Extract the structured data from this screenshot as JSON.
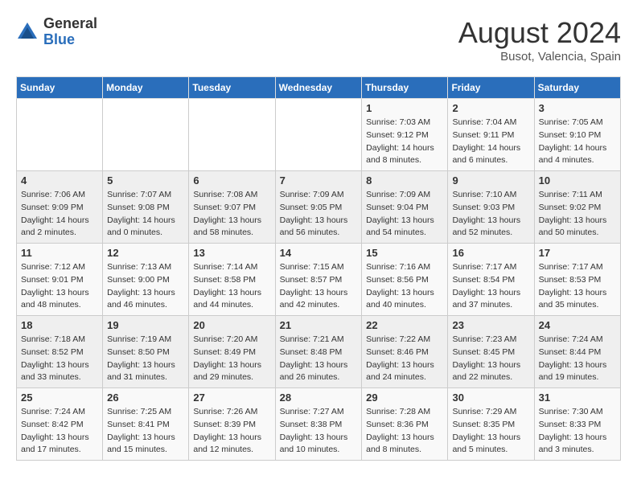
{
  "header": {
    "logo_general": "General",
    "logo_blue": "Blue",
    "month_year": "August 2024",
    "location": "Busot, Valencia, Spain"
  },
  "days_of_week": [
    "Sunday",
    "Monday",
    "Tuesday",
    "Wednesday",
    "Thursday",
    "Friday",
    "Saturday"
  ],
  "weeks": [
    [
      {
        "day": "",
        "info": ""
      },
      {
        "day": "",
        "info": ""
      },
      {
        "day": "",
        "info": ""
      },
      {
        "day": "",
        "info": ""
      },
      {
        "day": "1",
        "info": "Sunrise: 7:03 AM\nSunset: 9:12 PM\nDaylight: 14 hours\nand 8 minutes."
      },
      {
        "day": "2",
        "info": "Sunrise: 7:04 AM\nSunset: 9:11 PM\nDaylight: 14 hours\nand 6 minutes."
      },
      {
        "day": "3",
        "info": "Sunrise: 7:05 AM\nSunset: 9:10 PM\nDaylight: 14 hours\nand 4 minutes."
      }
    ],
    [
      {
        "day": "4",
        "info": "Sunrise: 7:06 AM\nSunset: 9:09 PM\nDaylight: 14 hours\nand 2 minutes."
      },
      {
        "day": "5",
        "info": "Sunrise: 7:07 AM\nSunset: 9:08 PM\nDaylight: 14 hours\nand 0 minutes."
      },
      {
        "day": "6",
        "info": "Sunrise: 7:08 AM\nSunset: 9:07 PM\nDaylight: 13 hours\nand 58 minutes."
      },
      {
        "day": "7",
        "info": "Sunrise: 7:09 AM\nSunset: 9:05 PM\nDaylight: 13 hours\nand 56 minutes."
      },
      {
        "day": "8",
        "info": "Sunrise: 7:09 AM\nSunset: 9:04 PM\nDaylight: 13 hours\nand 54 minutes."
      },
      {
        "day": "9",
        "info": "Sunrise: 7:10 AM\nSunset: 9:03 PM\nDaylight: 13 hours\nand 52 minutes."
      },
      {
        "day": "10",
        "info": "Sunrise: 7:11 AM\nSunset: 9:02 PM\nDaylight: 13 hours\nand 50 minutes."
      }
    ],
    [
      {
        "day": "11",
        "info": "Sunrise: 7:12 AM\nSunset: 9:01 PM\nDaylight: 13 hours\nand 48 minutes."
      },
      {
        "day": "12",
        "info": "Sunrise: 7:13 AM\nSunset: 9:00 PM\nDaylight: 13 hours\nand 46 minutes."
      },
      {
        "day": "13",
        "info": "Sunrise: 7:14 AM\nSunset: 8:58 PM\nDaylight: 13 hours\nand 44 minutes."
      },
      {
        "day": "14",
        "info": "Sunrise: 7:15 AM\nSunset: 8:57 PM\nDaylight: 13 hours\nand 42 minutes."
      },
      {
        "day": "15",
        "info": "Sunrise: 7:16 AM\nSunset: 8:56 PM\nDaylight: 13 hours\nand 40 minutes."
      },
      {
        "day": "16",
        "info": "Sunrise: 7:17 AM\nSunset: 8:54 PM\nDaylight: 13 hours\nand 37 minutes."
      },
      {
        "day": "17",
        "info": "Sunrise: 7:17 AM\nSunset: 8:53 PM\nDaylight: 13 hours\nand 35 minutes."
      }
    ],
    [
      {
        "day": "18",
        "info": "Sunrise: 7:18 AM\nSunset: 8:52 PM\nDaylight: 13 hours\nand 33 minutes."
      },
      {
        "day": "19",
        "info": "Sunrise: 7:19 AM\nSunset: 8:50 PM\nDaylight: 13 hours\nand 31 minutes."
      },
      {
        "day": "20",
        "info": "Sunrise: 7:20 AM\nSunset: 8:49 PM\nDaylight: 13 hours\nand 29 minutes."
      },
      {
        "day": "21",
        "info": "Sunrise: 7:21 AM\nSunset: 8:48 PM\nDaylight: 13 hours\nand 26 minutes."
      },
      {
        "day": "22",
        "info": "Sunrise: 7:22 AM\nSunset: 8:46 PM\nDaylight: 13 hours\nand 24 minutes."
      },
      {
        "day": "23",
        "info": "Sunrise: 7:23 AM\nSunset: 8:45 PM\nDaylight: 13 hours\nand 22 minutes."
      },
      {
        "day": "24",
        "info": "Sunrise: 7:24 AM\nSunset: 8:44 PM\nDaylight: 13 hours\nand 19 minutes."
      }
    ],
    [
      {
        "day": "25",
        "info": "Sunrise: 7:24 AM\nSunset: 8:42 PM\nDaylight: 13 hours\nand 17 minutes."
      },
      {
        "day": "26",
        "info": "Sunrise: 7:25 AM\nSunset: 8:41 PM\nDaylight: 13 hours\nand 15 minutes."
      },
      {
        "day": "27",
        "info": "Sunrise: 7:26 AM\nSunset: 8:39 PM\nDaylight: 13 hours\nand 12 minutes."
      },
      {
        "day": "28",
        "info": "Sunrise: 7:27 AM\nSunset: 8:38 PM\nDaylight: 13 hours\nand 10 minutes."
      },
      {
        "day": "29",
        "info": "Sunrise: 7:28 AM\nSunset: 8:36 PM\nDaylight: 13 hours\nand 8 minutes."
      },
      {
        "day": "30",
        "info": "Sunrise: 7:29 AM\nSunset: 8:35 PM\nDaylight: 13 hours\nand 5 minutes."
      },
      {
        "day": "31",
        "info": "Sunrise: 7:30 AM\nSunset: 8:33 PM\nDaylight: 13 hours\nand 3 minutes."
      }
    ]
  ]
}
